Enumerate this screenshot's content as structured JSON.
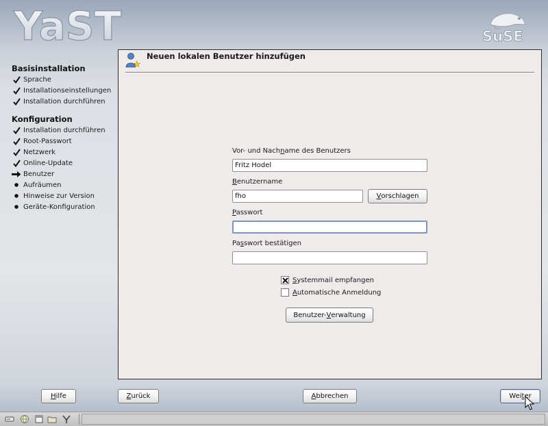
{
  "header": {
    "app_logo": "YaST",
    "vendor_logo": "SuSE"
  },
  "sidebar": {
    "sections": [
      {
        "title": "Basisinstallation",
        "steps": [
          {
            "label": "Sprache",
            "state": "done"
          },
          {
            "label": "Installationseinstellungen",
            "state": "done"
          },
          {
            "label": "Installation durchführen",
            "state": "done"
          }
        ]
      },
      {
        "title": "Konfiguration",
        "steps": [
          {
            "label": "Installation durchführen",
            "state": "done"
          },
          {
            "label": "Root-Passwort",
            "state": "done"
          },
          {
            "label": "Netzwerk",
            "state": "done"
          },
          {
            "label": "Online-Update",
            "state": "done"
          },
          {
            "label": "Benutzer",
            "state": "current"
          },
          {
            "label": "Aufräumen",
            "state": "pending"
          },
          {
            "label": "Hinweise zur Version",
            "state": "pending"
          },
          {
            "label": "Geräte-Konfiguration",
            "state": "pending"
          }
        ]
      }
    ]
  },
  "dialog": {
    "title": "Neuen lokalen Benutzer hinzufügen",
    "icon": "add-user-icon",
    "fullname": {
      "pre": "Vor- und Nach",
      "key": "n",
      "post": "ame des Benutzers",
      "value": "Fritz Hodel"
    },
    "username": {
      "pre": "",
      "key": "B",
      "post": "enutzername",
      "value": "fho"
    },
    "suggest_button": {
      "pre": "",
      "key": "V",
      "post": "orschlagen"
    },
    "password": {
      "pre": "",
      "key": "P",
      "post": "asswort",
      "value": ""
    },
    "password_confirm": {
      "pre": "Pa",
      "key": "s",
      "post": "swort bestätigen",
      "value": ""
    },
    "system_mail": {
      "pre": "",
      "key": "S",
      "post": "ystemmail empfangen",
      "checked": true
    },
    "auto_login": {
      "pre": "",
      "key": "A",
      "post": "utomatische Anmeldung",
      "checked": false
    },
    "user_admin_button": {
      "pre": "Benutzer-",
      "key": "V",
      "post": "erwaltung"
    }
  },
  "footer": {
    "help": {
      "pre": "",
      "key": "H",
      "post": "ilfe"
    },
    "back": {
      "pre": "",
      "key": "Z",
      "post": "urück"
    },
    "abort": {
      "pre": "",
      "key": "A",
      "post": "bbrechen"
    },
    "next": {
      "pre": "Wei",
      "key": "t",
      "post": "er"
    }
  },
  "taskbar": {
    "icons": [
      "drive-icon",
      "globe-icon",
      "window-icon",
      "folder-icon",
      "tools-icon"
    ]
  },
  "colors": {
    "panel_bg": "#efebeb",
    "focus_border": "#7e94b9"
  }
}
